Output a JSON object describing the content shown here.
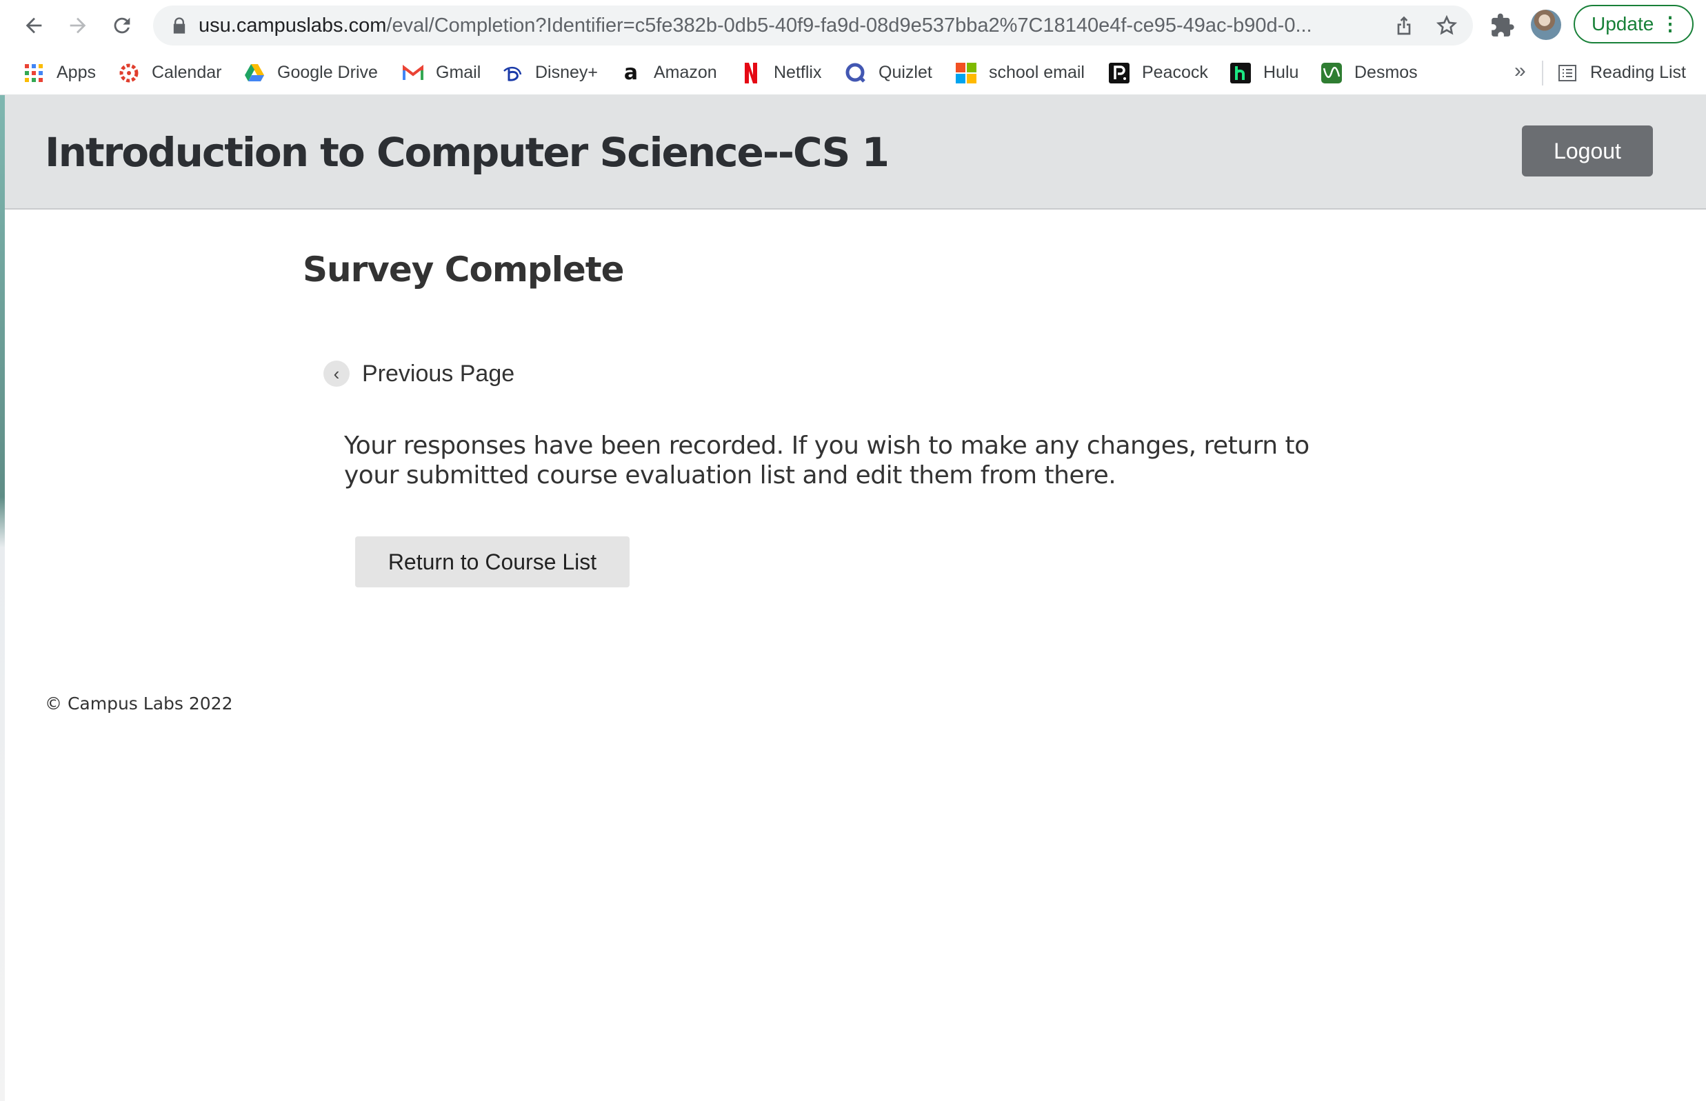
{
  "browser": {
    "url_host": "usu.campuslabs.com",
    "url_path": "/eval/Completion?Identifier=c5fe382b-0db5-40f9-fa9d-08d9e537bba2%7C18140e4f-ce95-49ac-b90d-0...",
    "update_label": "Update",
    "bookmarks": [
      {
        "label": "Apps",
        "icon": "apps-grid-icon"
      },
      {
        "label": "Calendar",
        "icon": "canvas-calendar-icon"
      },
      {
        "label": "Google Drive",
        "icon": "google-drive-icon"
      },
      {
        "label": "Gmail",
        "icon": "gmail-icon"
      },
      {
        "label": "Disney+",
        "icon": "disney-plus-icon"
      },
      {
        "label": "Amazon",
        "icon": "amazon-icon"
      },
      {
        "label": "Netflix",
        "icon": "netflix-icon"
      },
      {
        "label": "Quizlet",
        "icon": "quizlet-icon"
      },
      {
        "label": "school email",
        "icon": "microsoft-icon"
      },
      {
        "label": "Peacock",
        "icon": "peacock-icon"
      },
      {
        "label": "Hulu",
        "icon": "hulu-icon"
      },
      {
        "label": "Desmos",
        "icon": "desmos-icon"
      }
    ],
    "overflow_label": "»",
    "reading_list_label": "Reading List"
  },
  "header": {
    "course_title": "Introduction to Computer Science--CS 1",
    "logout_label": "Logout"
  },
  "main": {
    "title": "Survey Complete",
    "previous_label": "Previous Page",
    "previous_chevron": "‹",
    "message": "Your responses have been recorded. If you wish to make any changes, return to your submitted course evaluation list and edit them from there.",
    "return_label": "Return to Course List"
  },
  "footer": {
    "copyright": "© Campus Labs 2022"
  },
  "colors": {
    "header_bg": "#e1e3e4",
    "logout_bg": "#6b6e72",
    "update_green": "#188038"
  }
}
